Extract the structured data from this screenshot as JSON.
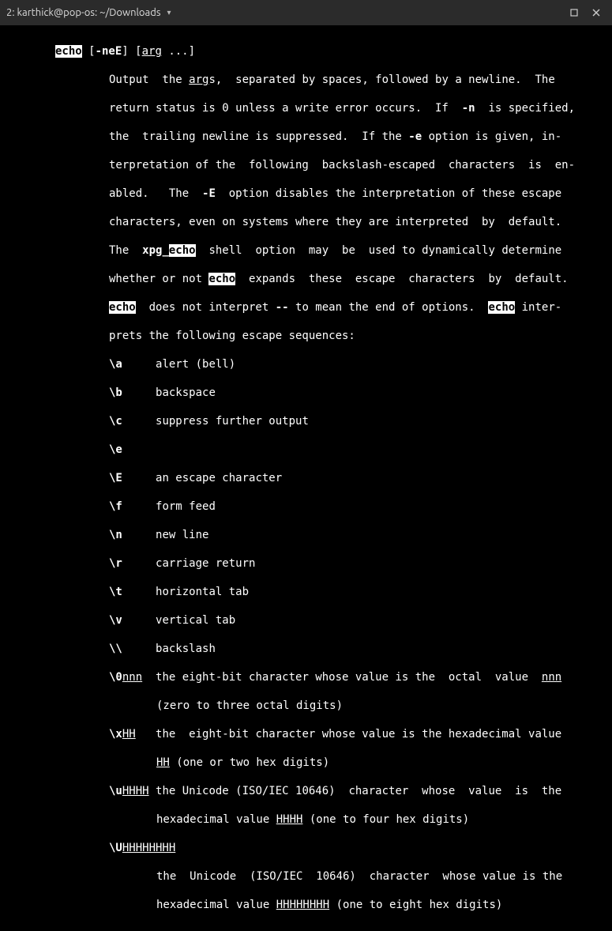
{
  "window": {
    "title": "2: karthick@pop-os: ~/Downloads"
  },
  "man": {
    "cmd": "echo",
    "opts": "-neE",
    "arg": "arg",
    "argrest": " ...]",
    "desc": {
      "l1a": "Output  the ",
      "l1b": "s,  separated by spaces, followed by a newline.  The",
      "l2a": "return status is 0 unless a write error occurs.  If  ",
      "l2b": "-n",
      "l2c": "  is specified,",
      "l3a": "the  trailing newline is suppressed.  If the ",
      "l3b": "-e",
      "l3c": " option is given, in-",
      "l4": "terpretation of the  following  backslash-escaped  characters  is  en-",
      "l5a": "abled.   The  ",
      "l5b": "-E",
      "l5c": "  option disables the interpretation of these escape",
      "l6": "characters, even on systems where they are interpreted  by  default.",
      "l7a": "The  ",
      "l7b": "xpg_",
      "l7c": "  shell  option  may  be  used to dynamically determine",
      "l8a": "whether or not ",
      "l8b": "  expands  these  escape  characters  by  default.",
      "l9a": "  does not interpret ",
      "l9b": "--",
      "l9c": " to mean the end of options.  ",
      "l9d": " inter-",
      "l10": "prets the following escape sequences:"
    },
    "esc": {
      "a": {
        "k": "\\a",
        "v": "alert (bell)"
      },
      "b": {
        "k": "\\b",
        "v": "backspace"
      },
      "c": {
        "k": "\\c",
        "v": "suppress further output"
      },
      "e": {
        "k": "\\e",
        "v": ""
      },
      "E": {
        "k": "\\E",
        "v": "an escape character"
      },
      "f": {
        "k": "\\f",
        "v": "form feed"
      },
      "n": {
        "k": "\\n",
        "v": "new line"
      },
      "r": {
        "k": "\\r",
        "v": "carriage return"
      },
      "t": {
        "k": "\\t",
        "v": "horizontal tab"
      },
      "v": {
        "k": "\\v",
        "v": "vertical tab"
      },
      "bs": {
        "k": "\\\\",
        "v": "backslash"
      },
      "zero": {
        "k": "\\0",
        "arg": "nnn",
        "v1": "the eight-bit character whose value is the  octal  value  ",
        "v2": "(zero to three octal digits)"
      },
      "x": {
        "k": "\\x",
        "arg": "HH",
        "v1": "the  eight-bit character whose value is the hexadecimal value",
        "v2a": " (one or two hex digits)"
      },
      "u": {
        "k": "\\u",
        "arg": "HHHH",
        "v1": "the Unicode (ISO/IEC 10646)  character  whose  value  is  the",
        "v2a": "hexadecimal value ",
        "v2b": " (one to four hex digits)"
      },
      "U": {
        "k": "\\U",
        "arg": "HHHHHHHH",
        "v1": "the  Unicode  (ISO/IEC  10646)  character  whose value is the",
        "v2a": "hexadecimal value ",
        "v2b": " (one to eight hex digits)"
      }
    }
  }
}
